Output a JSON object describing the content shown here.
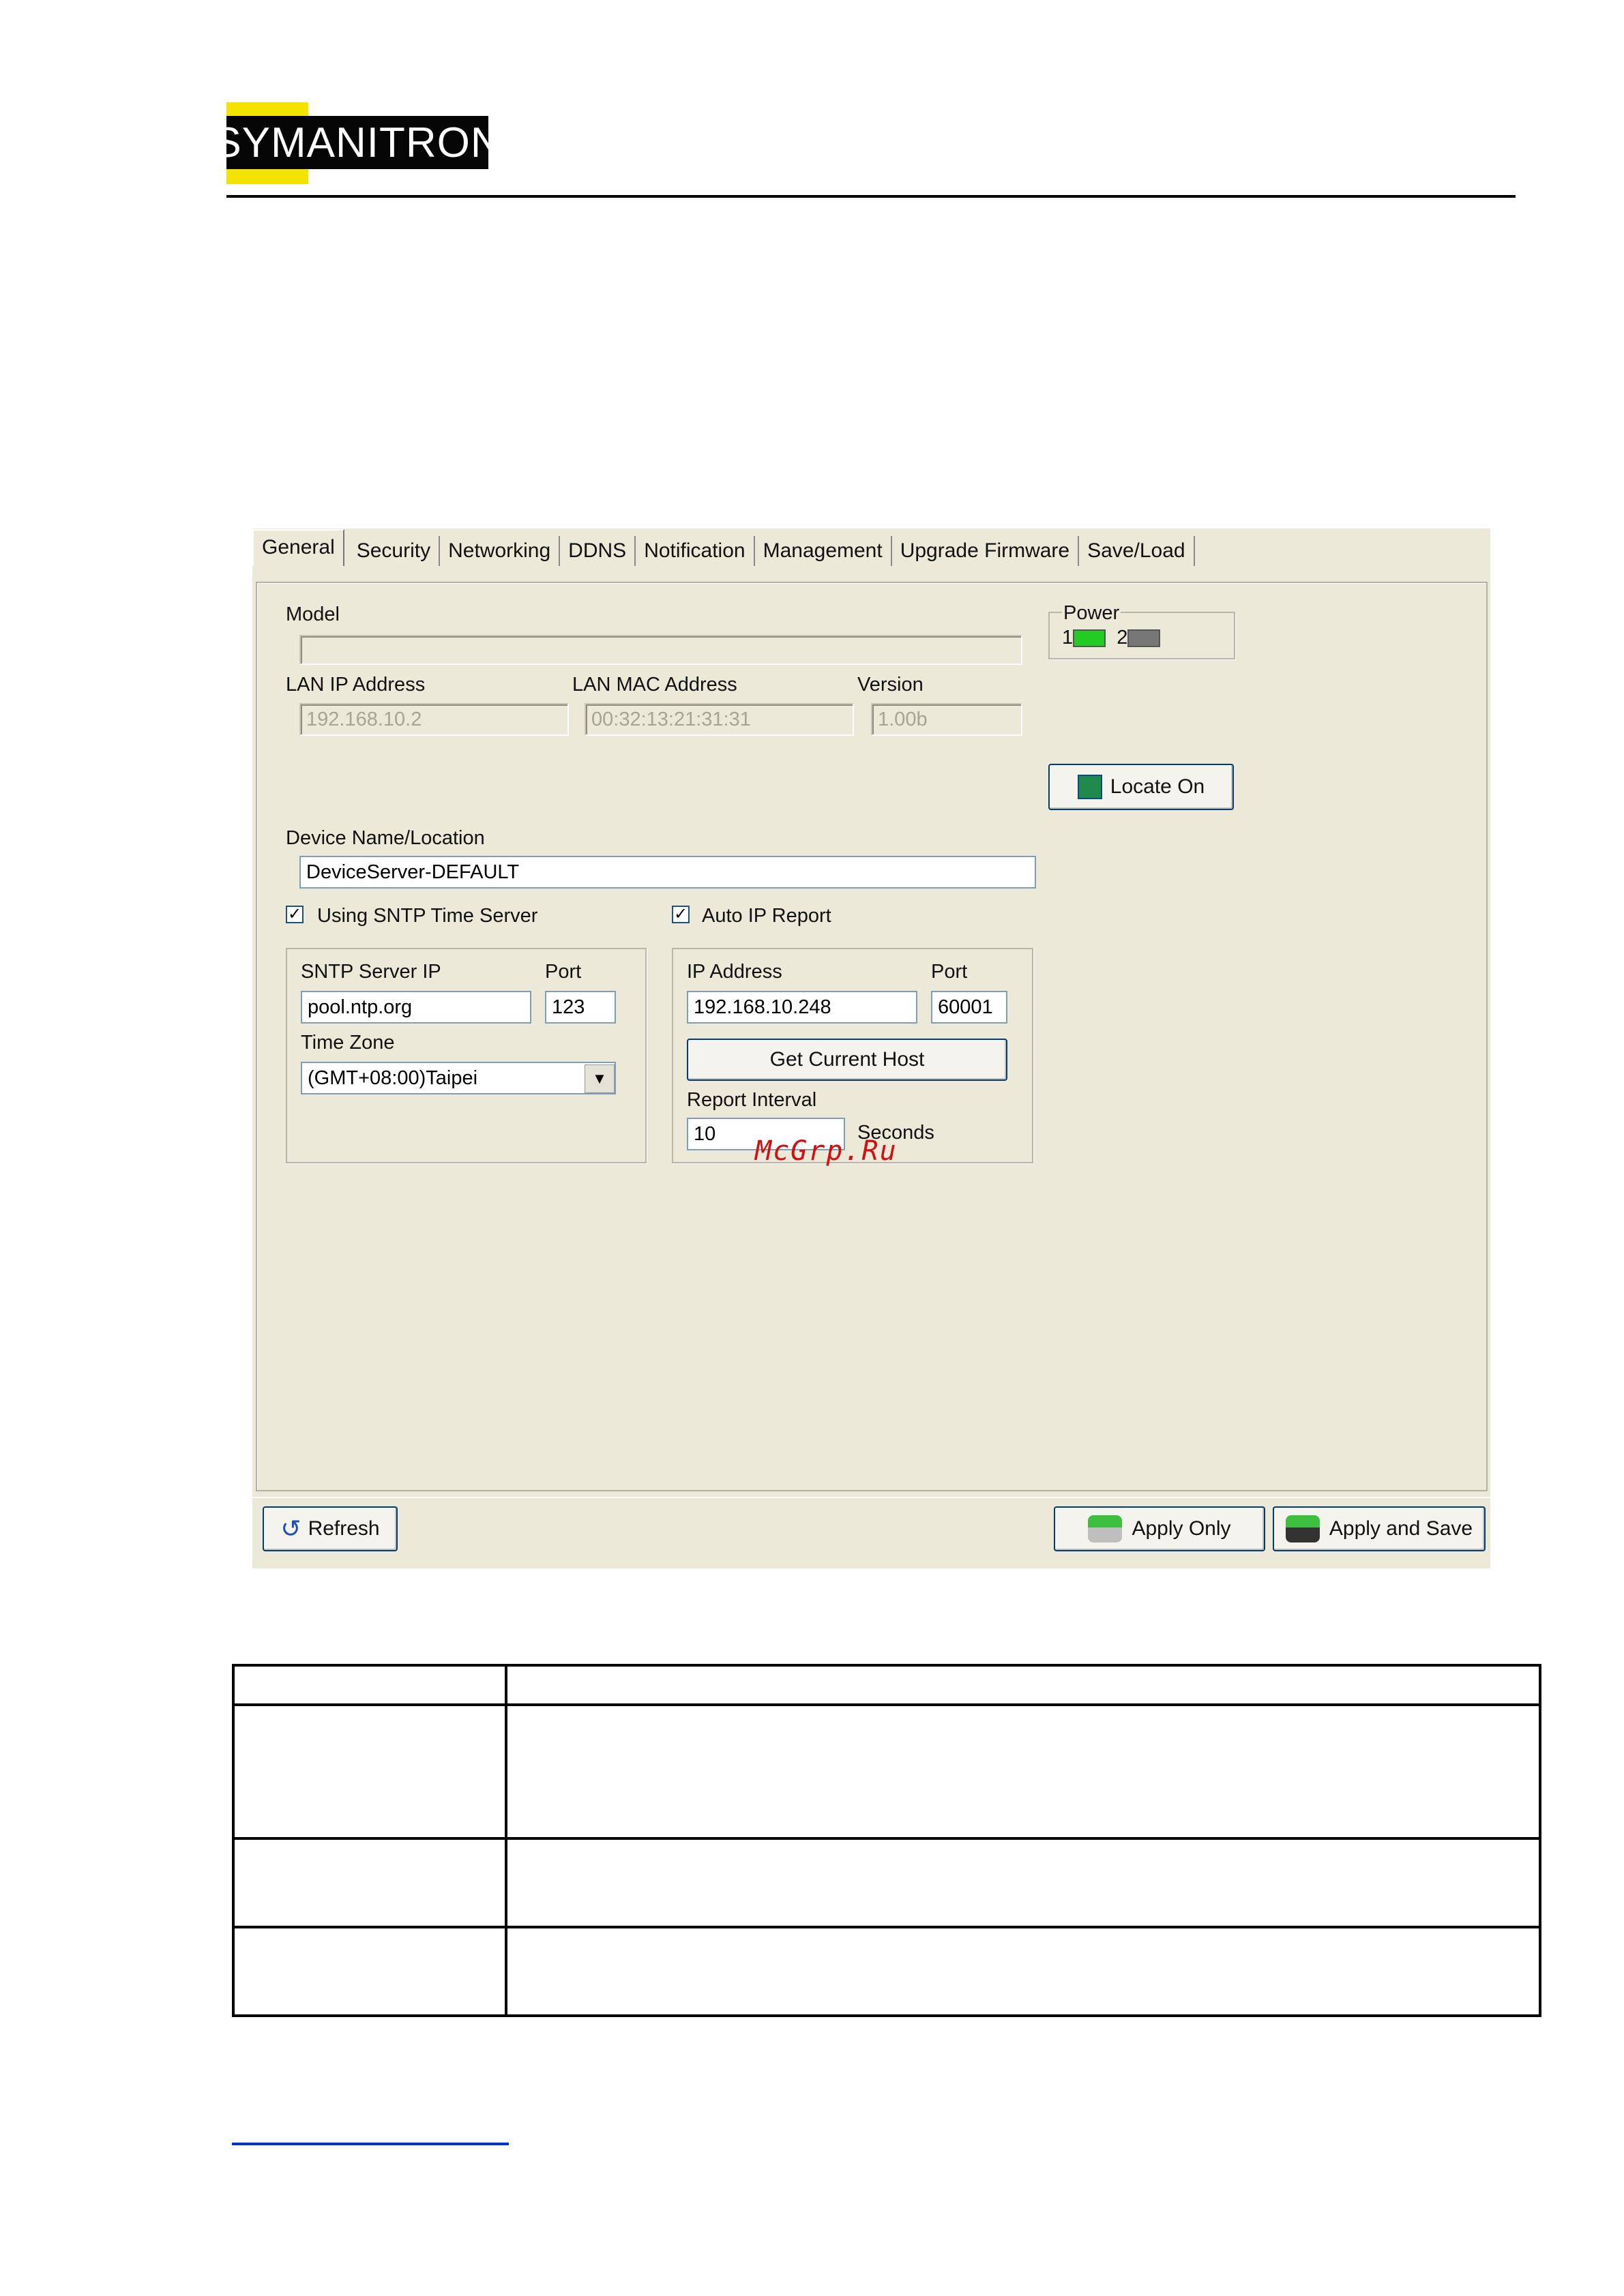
{
  "header": {
    "logo_text": "SYMANITRON"
  },
  "tabs": [
    "General",
    "Security",
    "Networking",
    "DDNS",
    "Notification",
    "Management",
    "Upgrade Firmware",
    "Save/Load"
  ],
  "general": {
    "model_label": "Model",
    "model_value": "",
    "power_label": "Power",
    "power_1_label": "1",
    "power_2_label": "2",
    "power_1_color": "#22cc22",
    "power_2_color": "#777777",
    "lan_ip_label": "LAN IP Address",
    "lan_ip_value": "192.168.10.2",
    "lan_mac_label": "LAN MAC Address",
    "lan_mac_value": "00:32:13:21:31:31",
    "version_label": "Version",
    "version_value": "1.00b",
    "locate_button": "Locate On",
    "device_name_label": "Device Name/Location",
    "device_name_value": "DeviceServer-DEFAULT",
    "sntp_checkbox_label": "Using SNTP Time Server",
    "sntp_checked": true,
    "sntp_server_label": "SNTP Server IP",
    "sntp_server_value": "pool.ntp.org",
    "sntp_port_label": "Port",
    "sntp_port_value": "123",
    "timezone_label": "Time Zone",
    "timezone_value": "(GMT+08:00)Taipei",
    "autoip_checkbox_label": "Auto IP Report",
    "autoip_checked": true,
    "ip_address_label": "IP Address",
    "ip_address_value": "192.168.10.248",
    "report_port_label": "Port",
    "report_port_value": "60001",
    "get_host_button": "Get Current Host",
    "report_interval_label": "Report Interval",
    "report_interval_value": "10",
    "seconds_label": "Seconds"
  },
  "watermark": "McGrp.Ru",
  "bottom": {
    "refresh_button": "Refresh",
    "apply_only_button": "Apply Only",
    "apply_save_button": "Apply and Save"
  },
  "table": {
    "rows": [
      [
        "",
        ""
      ],
      [
        "",
        ""
      ],
      [
        "",
        ""
      ],
      [
        "",
        ""
      ]
    ]
  }
}
